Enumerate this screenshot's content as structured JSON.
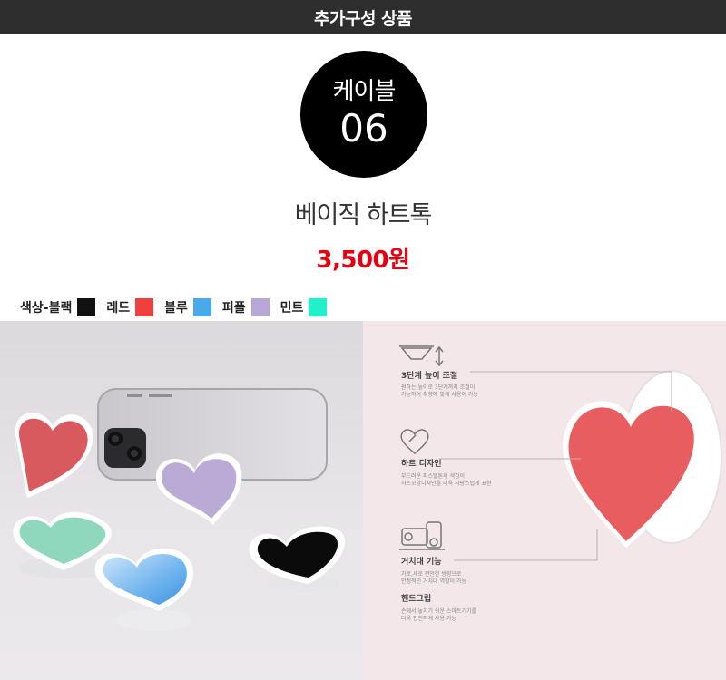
{
  "header": {
    "title": "추가구성 상품"
  },
  "badge": {
    "line1": "케이블",
    "line2": "06"
  },
  "product": {
    "name": "베이직 하트톡",
    "price": "3,500원"
  },
  "colors": {
    "label": "색상-블랙",
    "items": [
      {
        "name": "",
        "hex": "#111111"
      },
      {
        "name": "레드",
        "hex": "#ef4040"
      },
      {
        "name": "블루",
        "hex": "#4aa8ec"
      },
      {
        "name": "퍼플",
        "hex": "#b8a6d6"
      },
      {
        "name": "민트",
        "hex": "#22f0c8"
      }
    ]
  },
  "features": [
    {
      "title": "3단계 높이 조절",
      "desc1": "원하는 높이로 3단계까지 조절이",
      "desc2": "가능하여 취향에 맞게 사용이 가능"
    },
    {
      "title": "하트 디자인",
      "desc1": "부드러운 파스텔톤의 색감이",
      "desc2": "하트모양디자인을 더욱 사랑스럽게 표현"
    },
    {
      "title": "거치대 기능",
      "desc1": "가로,세로 편안한 방향으로",
      "desc2": "안정적인 거치대 역할이 가능"
    },
    {
      "title": "핸드그립",
      "desc1": "손에서 놓치기 쉬운 스마트기기를",
      "desc2": "더욱 안전하게 사용 가능"
    }
  ]
}
